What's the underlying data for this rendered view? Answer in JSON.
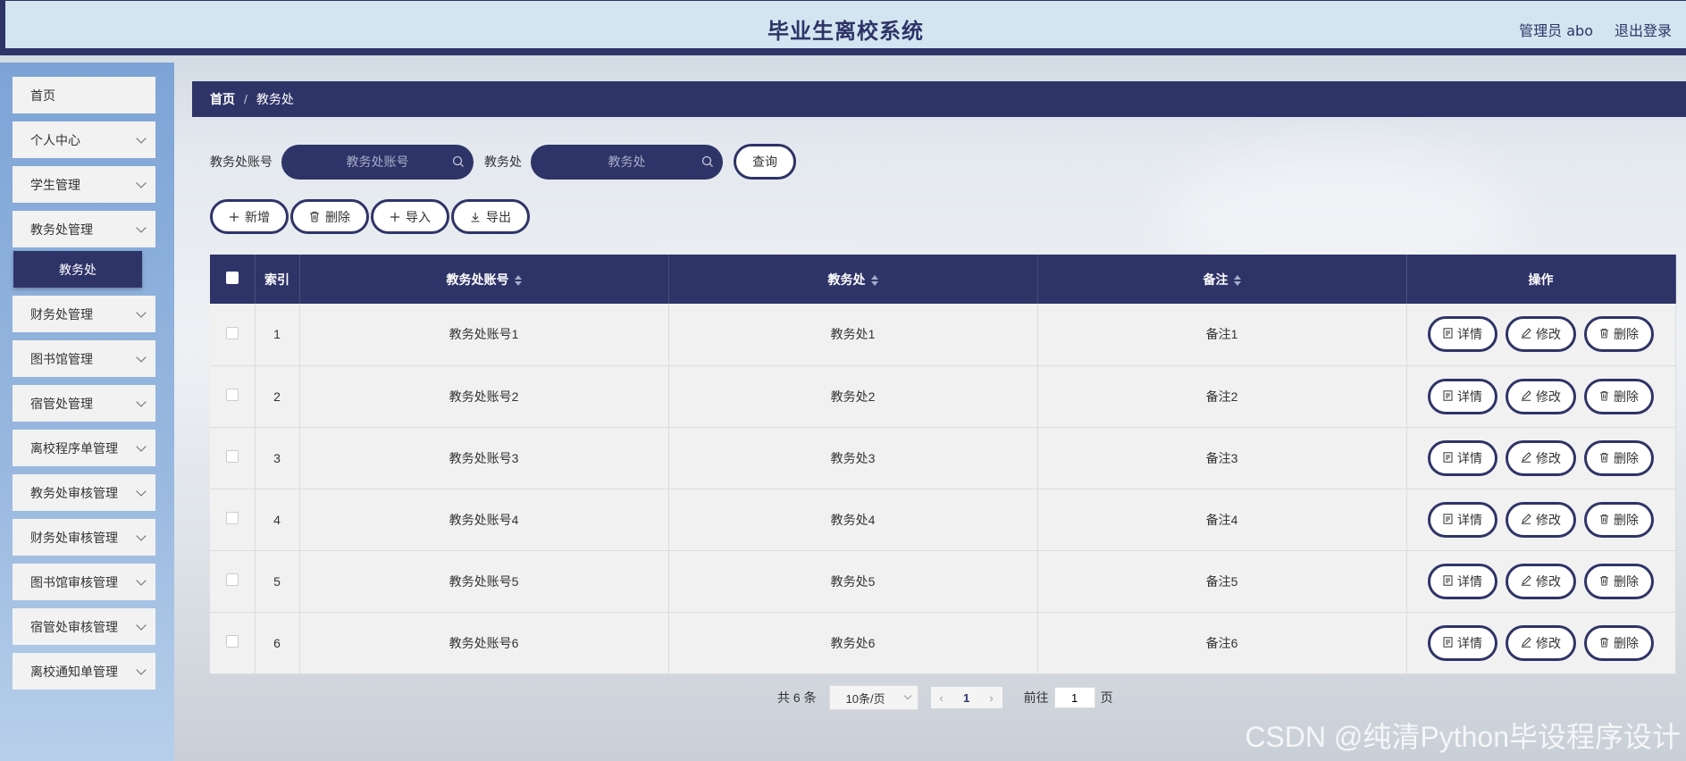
{
  "header": {
    "title": "毕业生离校系统",
    "user_label": "管理员 abo",
    "logout_label": "退出登录"
  },
  "sidebar": {
    "items": [
      {
        "label": "首页",
        "has_chevron": false
      },
      {
        "label": "个人中心",
        "has_chevron": true
      },
      {
        "label": "学生管理",
        "has_chevron": true
      },
      {
        "label": "教务处管理",
        "has_chevron": true
      },
      {
        "label": "财务处管理",
        "has_chevron": true
      },
      {
        "label": "图书馆管理",
        "has_chevron": true
      },
      {
        "label": "宿管处管理",
        "has_chevron": true
      },
      {
        "label": "离校程序单管理",
        "has_chevron": true
      },
      {
        "label": "教务处审核管理",
        "has_chevron": true
      },
      {
        "label": "财务处审核管理",
        "has_chevron": true
      },
      {
        "label": "图书馆审核管理",
        "has_chevron": true
      },
      {
        "label": "宿管处审核管理",
        "has_chevron": true
      },
      {
        "label": "离校通知单管理",
        "has_chevron": true
      }
    ],
    "active_sub": "教务处"
  },
  "breadcrumb": {
    "home": "首页",
    "separator": "/",
    "current": "教务处"
  },
  "search": {
    "account_label": "教务处账号",
    "account_placeholder": "教务处账号",
    "name_label": "教务处",
    "name_placeholder": "教务处",
    "query_label": "查询"
  },
  "actions": {
    "add": "新增",
    "delete": "删除",
    "import": "导入",
    "export": "导出"
  },
  "table": {
    "headers": {
      "index": "索引",
      "account": "教务处账号",
      "name": "教务处",
      "remark": "备注",
      "operation": "操作"
    },
    "row_actions": {
      "detail": "详情",
      "edit": "修改",
      "delete": "删除"
    },
    "rows": [
      {
        "index": "1",
        "account": "教务处账号1",
        "name": "教务处1",
        "remark": "备注1"
      },
      {
        "index": "2",
        "account": "教务处账号2",
        "name": "教务处2",
        "remark": "备注2"
      },
      {
        "index": "3",
        "account": "教务处账号3",
        "name": "教务处3",
        "remark": "备注3"
      },
      {
        "index": "4",
        "account": "教务处账号4",
        "name": "教务处4",
        "remark": "备注4"
      },
      {
        "index": "5",
        "account": "教务处账号5",
        "name": "教务处5",
        "remark": "备注5"
      },
      {
        "index": "6",
        "account": "教务处账号6",
        "name": "教务处6",
        "remark": "备注6"
      }
    ]
  },
  "pagination": {
    "total": "共 6 条",
    "page_size": "10条/页",
    "current_page": "1",
    "goto_prefix": "前往",
    "goto_value": "1",
    "goto_suffix": "页"
  },
  "watermark": "CSDN @纯清Python毕设程序设计",
  "colors": {
    "primary": "#2e3467",
    "header_bg": "#d3e5f0",
    "sidebar_bg": "#8aaedc",
    "row_bg": "#f1f1f1"
  }
}
